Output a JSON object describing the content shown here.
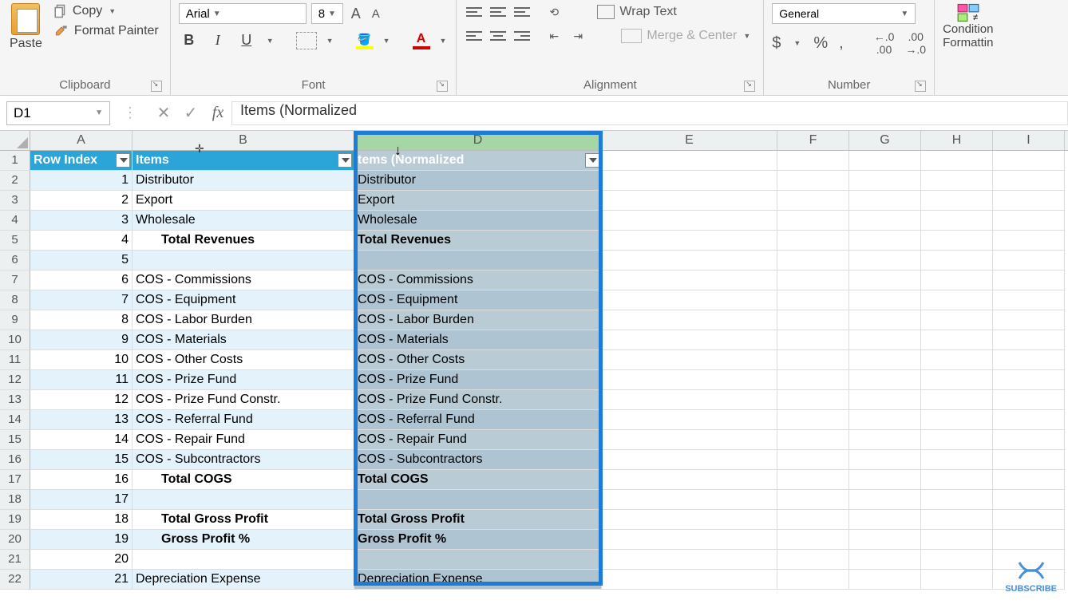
{
  "ribbon": {
    "clipboard": {
      "label": "Clipboard",
      "paste": "Paste",
      "copy": "Copy",
      "painter": "Format Painter"
    },
    "font": {
      "label": "Font",
      "name": "Arial",
      "size": "8",
      "bold": "B",
      "italic": "I",
      "underline": "U"
    },
    "alignment": {
      "label": "Alignment",
      "wrap": "Wrap Text",
      "merge": "Merge & Center"
    },
    "number": {
      "label": "Number",
      "format": "General",
      "cur": "$",
      "pct": "%",
      "comma": ","
    },
    "cf": {
      "line1": "Condition",
      "line2": "Formattin"
    }
  },
  "formula_bar": {
    "name_box": "D1",
    "value": "Items (Normalized"
  },
  "columns": [
    "A",
    "B",
    "D",
    "E",
    "F",
    "G",
    "H",
    "I"
  ],
  "headers": {
    "a": "Row Index",
    "b": "Items",
    "d": "tems (Normalized"
  },
  "rows": [
    {
      "n": 1,
      "idx": "",
      "b_hdr": true,
      "b": "Items",
      "d_hdr": true,
      "d": "tems (Normalized",
      "zebra": "a"
    },
    {
      "n": 2,
      "idx": "1",
      "b": "Distributor",
      "d": "Distributor",
      "zebra": "a"
    },
    {
      "n": 3,
      "idx": "2",
      "b": "Export",
      "d": "Export",
      "zebra": "b"
    },
    {
      "n": 4,
      "idx": "3",
      "b": "Wholesale",
      "d": "Wholesale",
      "zebra": "a"
    },
    {
      "n": 5,
      "idx": "4",
      "b": "Total Revenues",
      "d": "Total Revenues",
      "bold": true,
      "indent": true,
      "zebra": "b"
    },
    {
      "n": 6,
      "idx": "5",
      "b": "",
      "d": "",
      "zebra": "a"
    },
    {
      "n": 7,
      "idx": "6",
      "b": "COS - Commissions",
      "d": "COS - Commissions",
      "zebra": "b"
    },
    {
      "n": 8,
      "idx": "7",
      "b": "COS - Equipment",
      "d": "COS - Equipment",
      "zebra": "a"
    },
    {
      "n": 9,
      "idx": "8",
      "b": "COS - Labor Burden",
      "d": "COS - Labor Burden",
      "zebra": "b"
    },
    {
      "n": 10,
      "idx": "9",
      "b": "COS - Materials",
      "d": "COS - Materials",
      "zebra": "a"
    },
    {
      "n": 11,
      "idx": "10",
      "b": "COS - Other Costs",
      "d": "COS - Other Costs",
      "zebra": "b"
    },
    {
      "n": 12,
      "idx": "11",
      "b": "COS - Prize Fund",
      "d": "COS - Prize Fund",
      "zebra": "a"
    },
    {
      "n": 13,
      "idx": "12",
      "b": "COS - Prize Fund Constr.",
      "d": "COS - Prize Fund Constr.",
      "zebra": "b"
    },
    {
      "n": 14,
      "idx": "13",
      "b": "COS - Referral Fund",
      "d": "COS - Referral Fund",
      "zebra": "a"
    },
    {
      "n": 15,
      "idx": "14",
      "b": "COS - Repair Fund",
      "d": "COS - Repair Fund",
      "zebra": "b"
    },
    {
      "n": 16,
      "idx": "15",
      "b": "COS - Subcontractors",
      "d": "COS - Subcontractors",
      "zebra": "a"
    },
    {
      "n": 17,
      "idx": "16",
      "b": "Total COGS",
      "d": "Total COGS",
      "bold": true,
      "indent": true,
      "zebra": "b"
    },
    {
      "n": 18,
      "idx": "17",
      "b": "",
      "d": "",
      "zebra": "a"
    },
    {
      "n": 19,
      "idx": "18",
      "b": "Total Gross Profit",
      "d": "Total Gross Profit",
      "bold": true,
      "indent": true,
      "zebra": "b"
    },
    {
      "n": 20,
      "idx": "19",
      "b": "Gross Profit %",
      "d": "Gross Profit %",
      "bold": true,
      "indent": true,
      "zebra": "a"
    },
    {
      "n": 21,
      "idx": "20",
      "b": "",
      "d": "",
      "zebra": "b"
    },
    {
      "n": 22,
      "idx": "21",
      "b": "Depreciation Expense",
      "d": "Depreciation Expense",
      "zebra": "a"
    }
  ],
  "subscribe": "SUBSCRIBE"
}
